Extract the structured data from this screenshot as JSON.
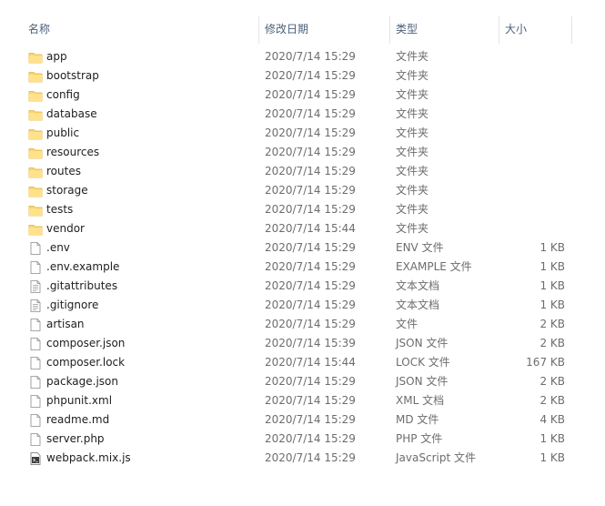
{
  "header": {
    "name": "名称",
    "modified": "修改日期",
    "type": "类型",
    "size": "大小"
  },
  "files": [
    {
      "name": "app",
      "modified": "2020/7/14 15:29",
      "type": "文件夹",
      "size": "",
      "icon": "folder-icon"
    },
    {
      "name": "bootstrap",
      "modified": "2020/7/14 15:29",
      "type": "文件夹",
      "size": "",
      "icon": "folder-icon"
    },
    {
      "name": "config",
      "modified": "2020/7/14 15:29",
      "type": "文件夹",
      "size": "",
      "icon": "folder-icon"
    },
    {
      "name": "database",
      "modified": "2020/7/14 15:29",
      "type": "文件夹",
      "size": "",
      "icon": "folder-icon"
    },
    {
      "name": "public",
      "modified": "2020/7/14 15:29",
      "type": "文件夹",
      "size": "",
      "icon": "folder-icon"
    },
    {
      "name": "resources",
      "modified": "2020/7/14 15:29",
      "type": "文件夹",
      "size": "",
      "icon": "folder-icon"
    },
    {
      "name": "routes",
      "modified": "2020/7/14 15:29",
      "type": "文件夹",
      "size": "",
      "icon": "folder-icon"
    },
    {
      "name": "storage",
      "modified": "2020/7/14 15:29",
      "type": "文件夹",
      "size": "",
      "icon": "folder-icon"
    },
    {
      "name": "tests",
      "modified": "2020/7/14 15:29",
      "type": "文件夹",
      "size": "",
      "icon": "folder-icon"
    },
    {
      "name": "vendor",
      "modified": "2020/7/14 15:44",
      "type": "文件夹",
      "size": "",
      "icon": "folder-icon"
    },
    {
      "name": ".env",
      "modified": "2020/7/14 15:29",
      "type": "ENV 文件",
      "size": "1 KB",
      "icon": "blank-file-icon"
    },
    {
      "name": ".env.example",
      "modified": "2020/7/14 15:29",
      "type": "EXAMPLE 文件",
      "size": "1 KB",
      "icon": "blank-file-icon"
    },
    {
      "name": ".gitattributes",
      "modified": "2020/7/14 15:29",
      "type": "文本文档",
      "size": "1 KB",
      "icon": "text-file-icon"
    },
    {
      "name": ".gitignore",
      "modified": "2020/7/14 15:29",
      "type": "文本文档",
      "size": "1 KB",
      "icon": "text-file-icon"
    },
    {
      "name": "artisan",
      "modified": "2020/7/14 15:29",
      "type": "文件",
      "size": "2 KB",
      "icon": "blank-file-icon"
    },
    {
      "name": "composer.json",
      "modified": "2020/7/14 15:39",
      "type": "JSON 文件",
      "size": "2 KB",
      "icon": "blank-file-icon"
    },
    {
      "name": "composer.lock",
      "modified": "2020/7/14 15:44",
      "type": "LOCK 文件",
      "size": "167 KB",
      "icon": "blank-file-icon"
    },
    {
      "name": "package.json",
      "modified": "2020/7/14 15:29",
      "type": "JSON 文件",
      "size": "2 KB",
      "icon": "blank-file-icon"
    },
    {
      "name": "phpunit.xml",
      "modified": "2020/7/14 15:29",
      "type": "XML 文档",
      "size": "2 KB",
      "icon": "blank-file-icon"
    },
    {
      "name": "readme.md",
      "modified": "2020/7/14 15:29",
      "type": "MD 文件",
      "size": "4 KB",
      "icon": "blank-file-icon"
    },
    {
      "name": "server.php",
      "modified": "2020/7/14 15:29",
      "type": "PHP 文件",
      "size": "1 KB",
      "icon": "blank-file-icon"
    },
    {
      "name": "webpack.mix.js",
      "modified": "2020/7/14 15:29",
      "type": "JavaScript 文件",
      "size": "1 KB",
      "icon": "script-file-icon"
    }
  ],
  "colors": {
    "header_text": "#4c607a",
    "name_text": "#1e1e1e",
    "detail_text": "#6d6d6d",
    "folder": "#f8d775"
  }
}
